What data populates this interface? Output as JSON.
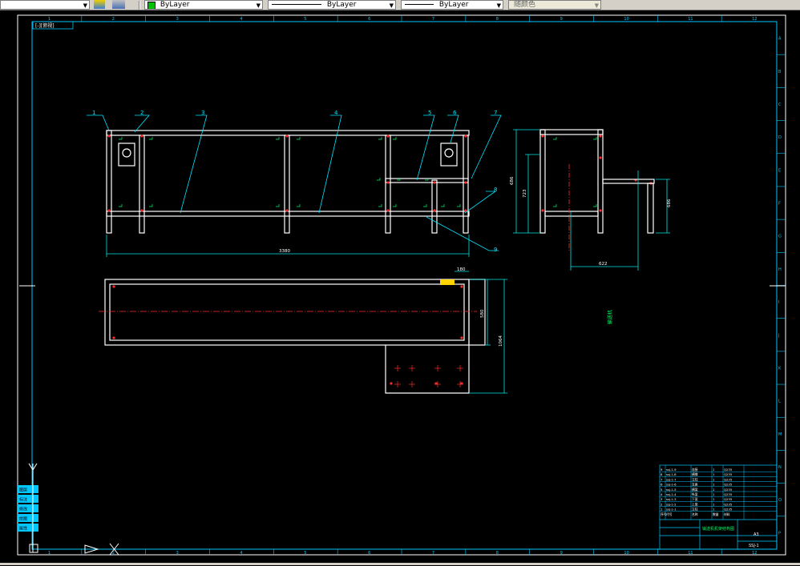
{
  "toolbar": {
    "layer_color_value": "ByLayer",
    "linetype_value": "ByLayer",
    "lineweight_value": "ByLayer",
    "plot_style_value": "随颜色"
  },
  "drawing": {
    "view_label": "[-][俯视]",
    "grid_columns": [
      "1",
      "2",
      "3",
      "4",
      "5",
      "6",
      "7",
      "8",
      "9",
      "10",
      "11",
      "12"
    ],
    "grid_rows": [
      "A",
      "B",
      "C",
      "D",
      "E",
      "F",
      "G",
      "H",
      "I",
      "J",
      "K",
      "L",
      "M",
      "N",
      "O",
      "P"
    ],
    "callouts": [
      "1",
      "2",
      "3",
      "4",
      "5",
      "6",
      "7",
      "8",
      "9"
    ],
    "dimensions": {
      "overall_length": "3380",
      "side_height_outer": "686",
      "side_height_inner": "723",
      "side_height_right": "686",
      "side_width": "622",
      "plan_width": "580",
      "plan_depth": "1064",
      "plan_step": "180"
    },
    "vertical_text": "输送机",
    "title_block": {
      "drawing_title": "输送机机架结构图",
      "scale": "A3",
      "drawing_number": "SSJ-1",
      "bom_rows": [
        {
          "no": "9",
          "code": "ssj-1-9",
          "name": "连接",
          "qty": "1",
          "mat": "Q235"
        },
        {
          "no": "8",
          "code": "ssj-1-8",
          "name": "横撑",
          "qty": "1",
          "mat": "Q235"
        },
        {
          "no": "7",
          "code": "ssj-1-7",
          "name": "立柱",
          "qty": "1",
          "mat": "Q235"
        },
        {
          "no": "6",
          "code": "ssj-1-6",
          "name": "支座",
          "qty": "1",
          "mat": "Q235"
        },
        {
          "no": "5",
          "code": "ssj-1-5",
          "name": "横梁",
          "qty": "1",
          "mat": "Q235"
        },
        {
          "no": "4",
          "code": "ssj-1-4",
          "name": "纵梁",
          "qty": "1",
          "mat": "Q235"
        },
        {
          "no": "3",
          "code": "ssj-1-3",
          "name": "下梁",
          "qty": "1",
          "mat": "Q235"
        },
        {
          "no": "2",
          "code": "ssj-1-2",
          "name": "上梁",
          "qty": "1",
          "mat": "Q235"
        },
        {
          "no": "1",
          "code": "ssj-1-1",
          "name": "立柱",
          "qty": "1",
          "mat": "Q235"
        }
      ],
      "header": {
        "no": "序号",
        "code": "代号",
        "name": "名称",
        "qty": "数量",
        "mat": "材料"
      }
    },
    "left_tools": [
      "图层",
      "标注",
      "修改",
      "绘图",
      "属性"
    ]
  },
  "colors": {
    "frame": "#ffffff",
    "border": "#00c8ff",
    "callout": "#00e5ff",
    "dim": "#00e5e5",
    "marker": "#ff2a2a",
    "title": "#00ff66",
    "yellow": "#ffd400"
  }
}
